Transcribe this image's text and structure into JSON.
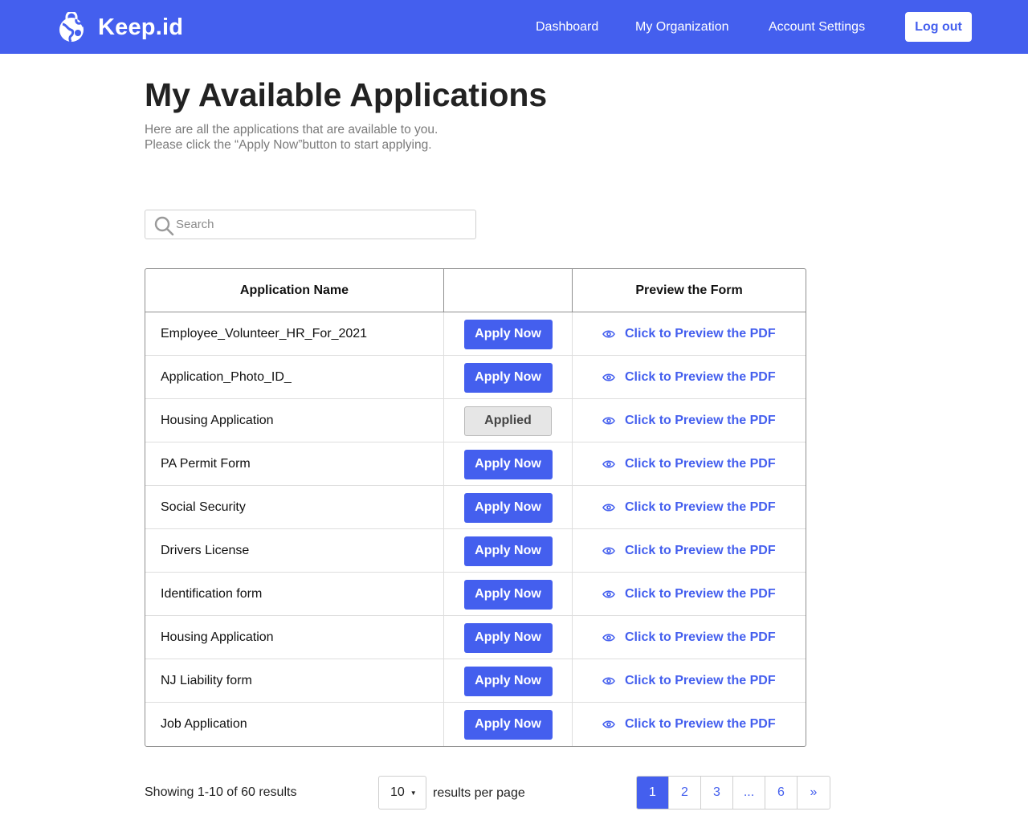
{
  "header": {
    "brand": "Keep.id",
    "nav": [
      "Dashboard",
      "My Organization",
      "Account Settings"
    ],
    "logout_label": "Log out"
  },
  "page": {
    "title": "My Available Applications",
    "subtitle_line1": "Here are all the applications that are available to you.",
    "subtitle_line2": "Please click the “Apply Now”button to start applying."
  },
  "search": {
    "placeholder": "Search",
    "value": ""
  },
  "table": {
    "headers": [
      "Application Name",
      "",
      "Preview the Form"
    ],
    "preview_label": "Click to Preview the PDF",
    "rows": [
      {
        "name": "Employee_Volunteer_HR_For_2021",
        "action": "Apply Now",
        "applied": false
      },
      {
        "name": "Application_Photo_ID_",
        "action": "Apply Now",
        "applied": false
      },
      {
        "name": "Housing Application",
        "action": "Applied",
        "applied": true
      },
      {
        "name": "PA Permit Form",
        "action": "Apply Now",
        "applied": false
      },
      {
        "name": "Social Security",
        "action": "Apply Now",
        "applied": false
      },
      {
        "name": "Drivers License",
        "action": "Apply Now",
        "applied": false
      },
      {
        "name": "Identification form",
        "action": "Apply Now",
        "applied": false
      },
      {
        "name": "Housing Application",
        "action": "Apply Now",
        "applied": false
      },
      {
        "name": "NJ Liability form",
        "action": "Apply Now",
        "applied": false
      },
      {
        "name": "Job Application",
        "action": "Apply Now",
        "applied": false
      }
    ]
  },
  "footer": {
    "showing": "Showing 1-10 of 60 results",
    "per_page_value": "10",
    "per_page_label": "results per page",
    "pages": [
      "1",
      "2",
      "3",
      "...",
      "6",
      "»"
    ],
    "active_page": "1"
  },
  "colors": {
    "accent": "#445fee",
    "applied_bg": "#e6e6e6"
  }
}
